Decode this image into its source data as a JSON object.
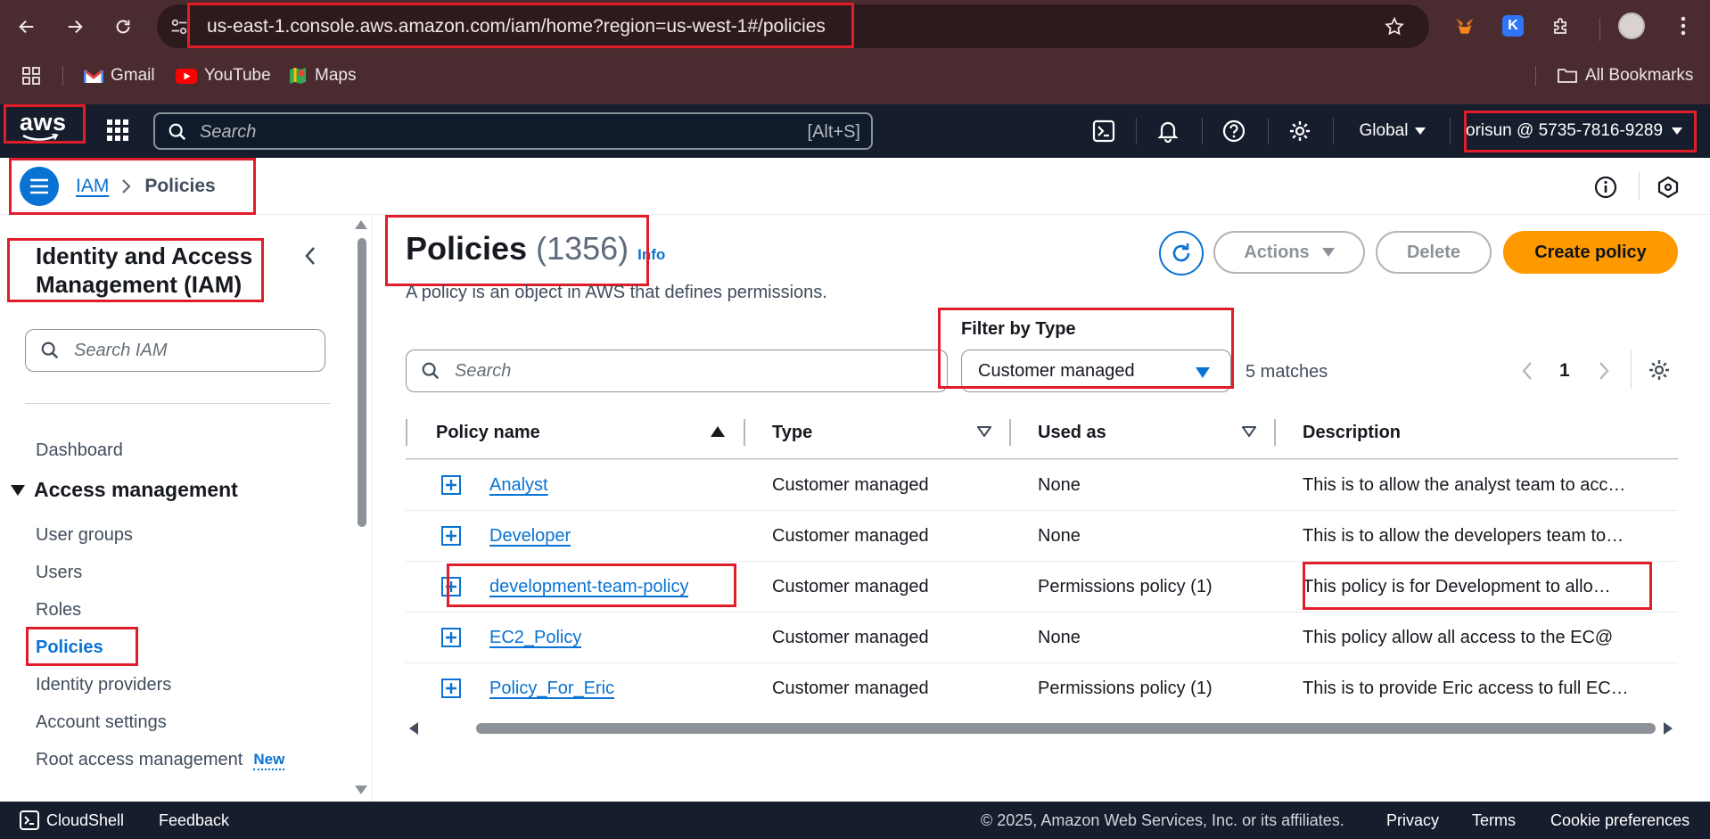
{
  "browser": {
    "url": "us-east-1.console.aws.amazon.com/iam/home?region=us-west-1#/policies",
    "bookmarks": [
      "Gmail",
      "YouTube",
      "Maps"
    ],
    "all_bookmarks": "All Bookmarks",
    "extension_letter": "K"
  },
  "topbar": {
    "logo": "aws",
    "search_placeholder": "Search",
    "search_shortcut": "[Alt+S]",
    "region": "Global",
    "account": "orisun @ 5735-7816-9289"
  },
  "breadcrumb": {
    "root": "IAM",
    "current": "Policies"
  },
  "sidebar": {
    "title_line1": "Identity and Access",
    "title_line2": "Management (IAM)",
    "search_placeholder": "Search IAM",
    "dashboard": "Dashboard",
    "section": "Access management",
    "items": [
      {
        "label": "User groups"
      },
      {
        "label": "Users"
      },
      {
        "label": "Roles"
      },
      {
        "label": "Policies",
        "active": true
      },
      {
        "label": "Identity providers"
      },
      {
        "label": "Account settings"
      },
      {
        "label": "Root access management",
        "badge": "New"
      }
    ]
  },
  "main": {
    "title": "Policies",
    "count": "(1356)",
    "info": "Info",
    "description": "A policy is an object in AWS that defines permissions.",
    "actions_label": "Actions",
    "delete_label": "Delete",
    "create_label": "Create policy",
    "filter_label": "Filter by Type",
    "filter_value": "Customer managed",
    "search_placeholder": "Search",
    "matches": "5 matches",
    "page": "1",
    "columns": [
      "Policy name",
      "Type",
      "Used as",
      "Description"
    ],
    "rows": [
      {
        "name": "Analyst",
        "type": "Customer managed",
        "used_as": "None",
        "description": "This is to allow the analyst team to acc…"
      },
      {
        "name": "Developer",
        "type": "Customer managed",
        "used_as": "None",
        "description": "This is to allow the developers team to…"
      },
      {
        "name": "development-team-policy",
        "type": "Customer managed",
        "used_as": "Permissions policy (1)",
        "description": "This policy is for Development to allo…"
      },
      {
        "name": "EC2_Policy",
        "type": "Customer managed",
        "used_as": "None",
        "description": "This policy allow all access to the EC@"
      },
      {
        "name": "Policy_For_Eric",
        "type": "Customer managed",
        "used_as": "Permissions policy (1)",
        "description": "This is to provide Eric access to full EC…"
      }
    ]
  },
  "footer": {
    "cloudshell": "CloudShell",
    "feedback": "Feedback",
    "copyright": "© 2025, Amazon Web Services, Inc. or its affiliates.",
    "privacy": "Privacy",
    "terms": "Terms",
    "cookies": "Cookie preferences"
  },
  "colors": {
    "chrome_bg": "#4a2b2f",
    "aws_nav": "#161e2d",
    "link": "#0972d3",
    "primary_button": "#ff9900",
    "highlight": "#e21d2a"
  }
}
